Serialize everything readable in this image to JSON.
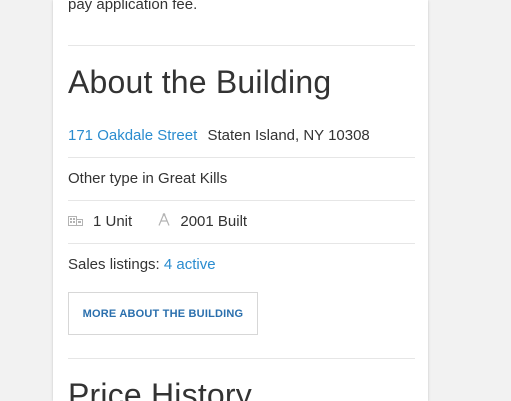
{
  "fee_text": "pay application fee.",
  "building": {
    "heading": "About the Building",
    "street_link": "171 Oakdale Street",
    "city_state_zip": "Staten Island, NY 10308",
    "type_text": "Other type in Great Kills",
    "units": {
      "icon": "building-icon",
      "label": "1 Unit"
    },
    "built": {
      "icon": "architect-icon",
      "label": "2001 Built"
    },
    "sales_label": "Sales listings:",
    "sales_link": "4 active",
    "more_button": "MORE ABOUT THE BUILDING"
  },
  "price_history": {
    "heading": "Price History"
  },
  "colors": {
    "link": "#2a8ccf",
    "button_text": "#2a6fad",
    "divider": "#e6e6e6",
    "background": "#f2f2f2"
  }
}
